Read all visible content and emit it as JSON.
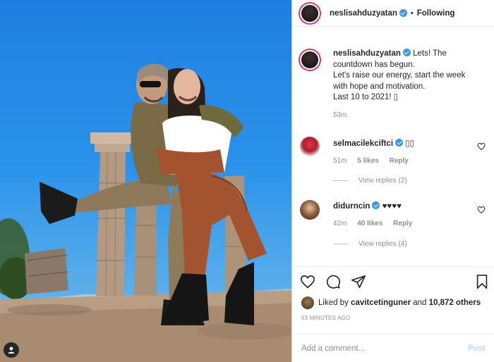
{
  "post": {
    "username": "neslisahduzyatan",
    "follow_state": "Following",
    "separator": "•",
    "caption_lines": [
      "Lets! The",
      "countdown has begun.",
      "Let's raise our energy, start the week",
      "with hope and motivation.",
      "Last 10 to 2021! ▯"
    ],
    "caption_time": "53m"
  },
  "comments": [
    {
      "username": "selmacilekciftci",
      "text": "▯▯",
      "time": "51m",
      "likes": "5 likes",
      "reply": "Reply",
      "view_replies": "View replies (2)"
    },
    {
      "username": "didurncin",
      "text": "♥♥♥♥",
      "time": "42m",
      "likes": "40 likes",
      "reply": "Reply",
      "view_replies": "View replies (4)"
    }
  ],
  "likes": {
    "prefix": "Liked by",
    "user": "cavitcetinguner",
    "middle": "and",
    "count": "10,872 others"
  },
  "timestamp": "53 MINUTES AGO",
  "add_comment": {
    "placeholder": "Add a comment...",
    "post_label": "Post"
  },
  "icons": {
    "like": "heart-icon",
    "comment": "comment-icon",
    "share": "share-icon",
    "save": "bookmark-icon",
    "tag": "person-tag-icon"
  },
  "colors": {
    "verified": "#3897f0",
    "post_disabled": "#b2dffc",
    "meta": "#8e8e8e",
    "story_ring": "#e1306c"
  }
}
